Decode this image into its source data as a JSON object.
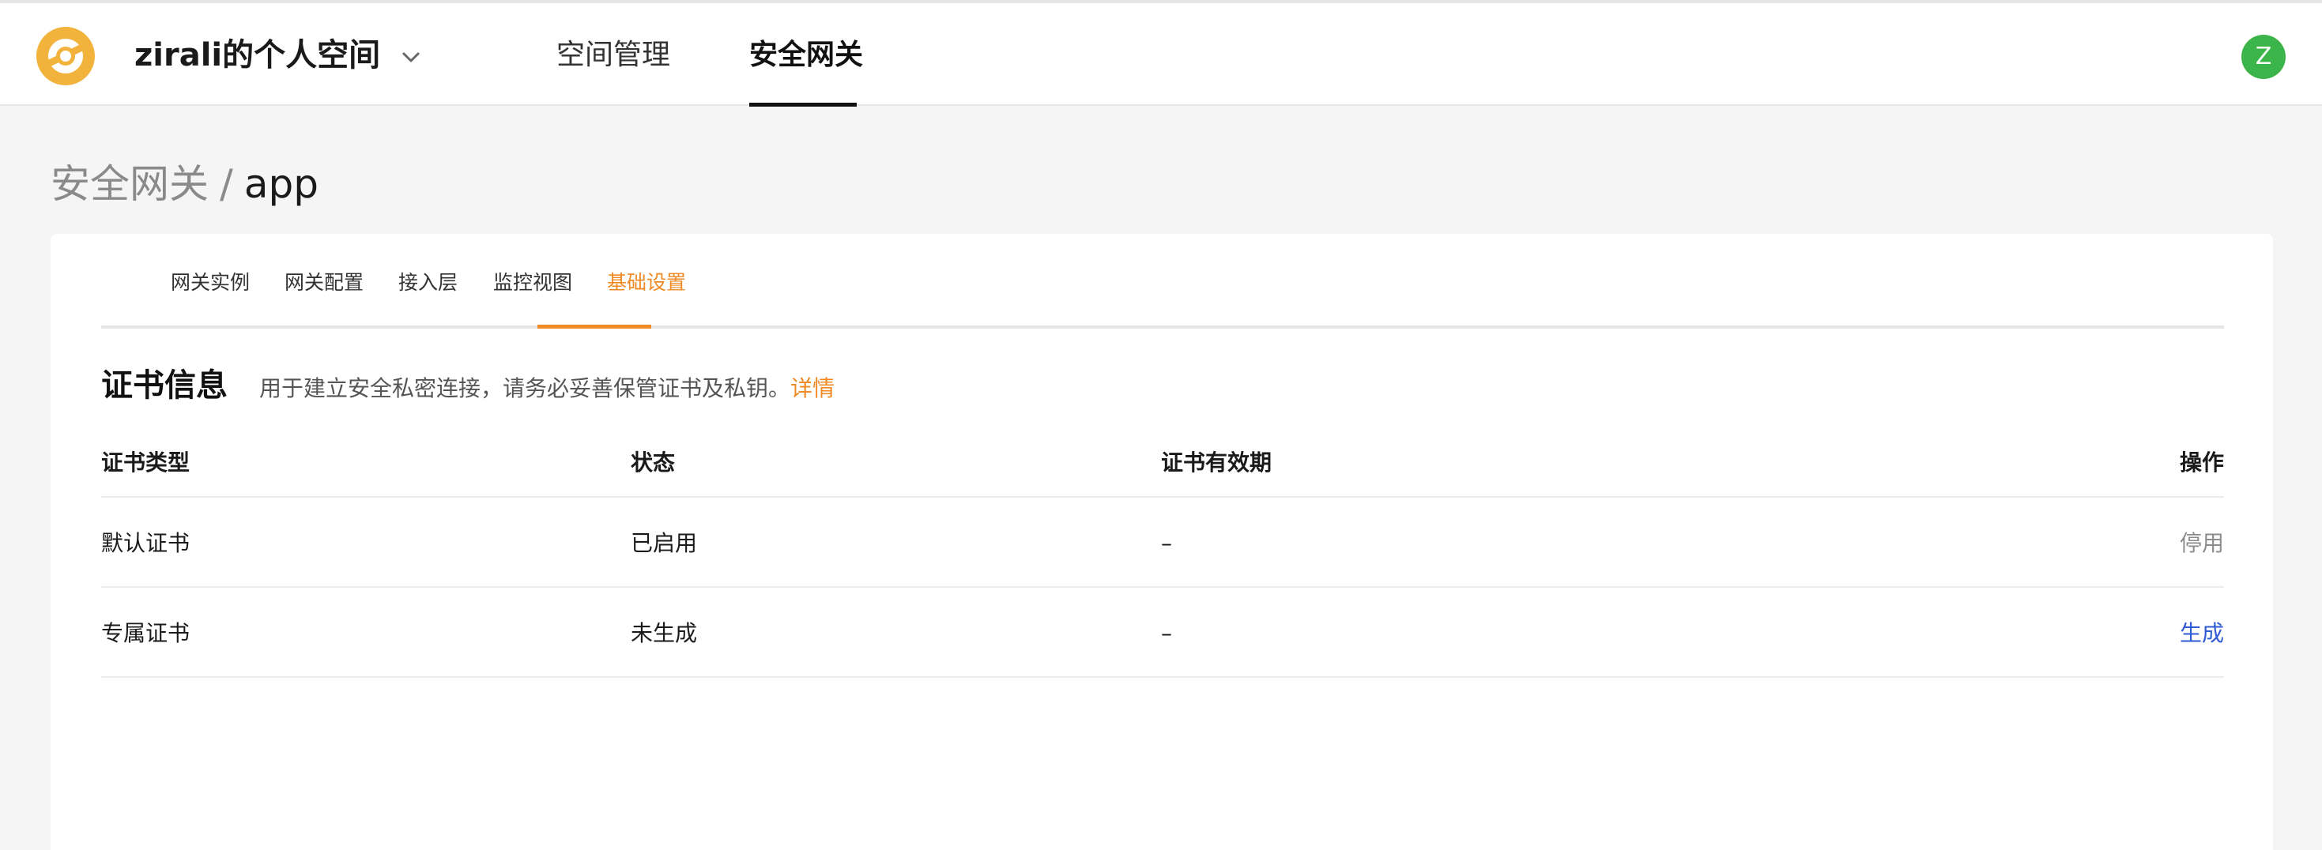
{
  "header": {
    "space_name": "zirali的个人空间",
    "nav": [
      {
        "label": "空间管理",
        "active": false
      },
      {
        "label": "安全网关",
        "active": true
      }
    ],
    "avatar_initial": "Z",
    "avatar_color": "#3bb54a"
  },
  "breadcrumb": {
    "parent": "安全网关",
    "separator": "/",
    "current": "app"
  },
  "tabs": [
    {
      "label": "网关实例",
      "active": false
    },
    {
      "label": "网关配置",
      "active": false
    },
    {
      "label": "接入层",
      "active": false
    },
    {
      "label": "监控视图",
      "active": false
    },
    {
      "label": "基础设置",
      "active": true
    }
  ],
  "certificate": {
    "title": "证书信息",
    "description": "用于建立安全私密连接，请务必妥善保管证书及私钥。",
    "detail_link": "详情",
    "columns": [
      "证书类型",
      "状态",
      "证书有效期",
      "操作"
    ],
    "rows": [
      {
        "type": "默认证书",
        "status": "已启用",
        "validity": "–",
        "action": "停用"
      },
      {
        "type": "专属证书",
        "status": "未生成",
        "validity": "–",
        "action": "生成"
      }
    ]
  },
  "colors": {
    "accent": "#f08a24",
    "link": "#2f5bd3",
    "logo": "#f2b33d"
  }
}
